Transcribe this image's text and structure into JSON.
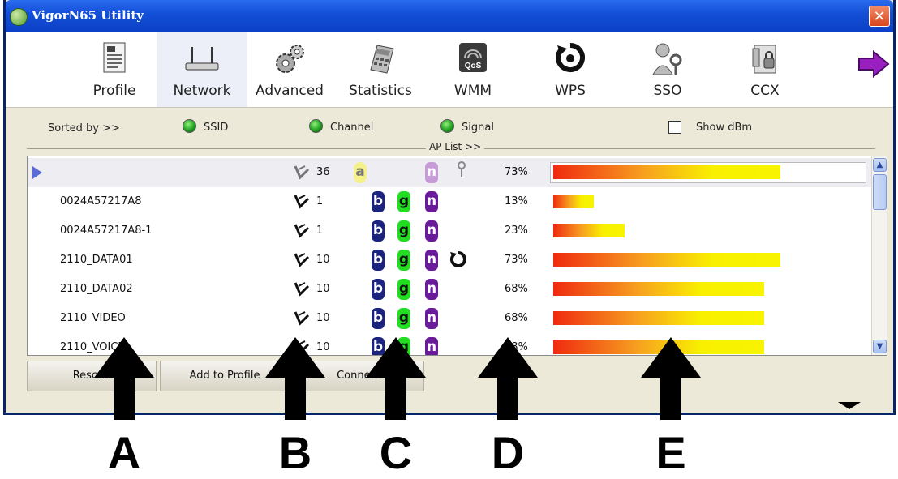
{
  "window": {
    "title": "VigorN65 Utility",
    "close_label": "✕"
  },
  "toolbar": {
    "items": [
      {
        "label": "Profile",
        "icon": "profile-icon"
      },
      {
        "label": "Network",
        "icon": "router-icon"
      },
      {
        "label": "Advanced",
        "icon": "gears-icon"
      },
      {
        "label": "Statistics",
        "icon": "calculator-icon"
      },
      {
        "label": "WMM",
        "icon": "qos-icon"
      },
      {
        "label": "WPS",
        "icon": "wps-icon"
      },
      {
        "label": "SSO",
        "icon": "sso-icon"
      },
      {
        "label": "CCX",
        "icon": "ccx-icon"
      }
    ],
    "next_icon": "next-arrow-icon"
  },
  "sort": {
    "label": "Sorted by >>",
    "options": [
      "SSID",
      "Channel",
      "Signal"
    ],
    "show_dbm_label": "Show dBm",
    "ap_list_label": "AP List >>"
  },
  "ap_list": [
    {
      "ssid": "",
      "channel": "36",
      "modes": [
        "a",
        "n"
      ],
      "secured": true,
      "wps": false,
      "signal": "73%",
      "signal_value": 0.73
    },
    {
      "ssid": "0024A57217A8",
      "channel": "1",
      "modes": [
        "b",
        "g",
        "n"
      ],
      "secured": false,
      "wps": false,
      "signal": "13%",
      "signal_value": 0.13
    },
    {
      "ssid": "0024A57217A8-1",
      "channel": "1",
      "modes": [
        "b",
        "g",
        "n"
      ],
      "secured": false,
      "wps": false,
      "signal": "23%",
      "signal_value": 0.23
    },
    {
      "ssid": "2110_DATA01",
      "channel": "10",
      "modes": [
        "b",
        "g",
        "n"
      ],
      "secured": false,
      "wps": true,
      "signal": "73%",
      "signal_value": 0.73
    },
    {
      "ssid": "2110_DATA02",
      "channel": "10",
      "modes": [
        "b",
        "g",
        "n"
      ],
      "secured": false,
      "wps": false,
      "signal": "68%",
      "signal_value": 0.68
    },
    {
      "ssid": "2110_VIDEO",
      "channel": "10",
      "modes": [
        "b",
        "g",
        "n"
      ],
      "secured": false,
      "wps": false,
      "signal": "68%",
      "signal_value": 0.68
    },
    {
      "ssid": "2110_VOICE",
      "channel": "10",
      "modes": [
        "b",
        "g",
        "n"
      ],
      "secured": false,
      "wps": false,
      "signal": "68%",
      "signal_value": 0.68
    }
  ],
  "buttons": {
    "rescan": "Rescan",
    "add_to_profile": "Add to Profile",
    "connect": "Connect"
  },
  "callouts": [
    "A",
    "B",
    "C",
    "D",
    "E"
  ],
  "colors": {
    "title_bar": "#1450d8",
    "radio": "#1a9c1a",
    "mode_b": "#1a237e",
    "mode_g": "#22dd22",
    "mode_n": "#6a1b9a"
  }
}
